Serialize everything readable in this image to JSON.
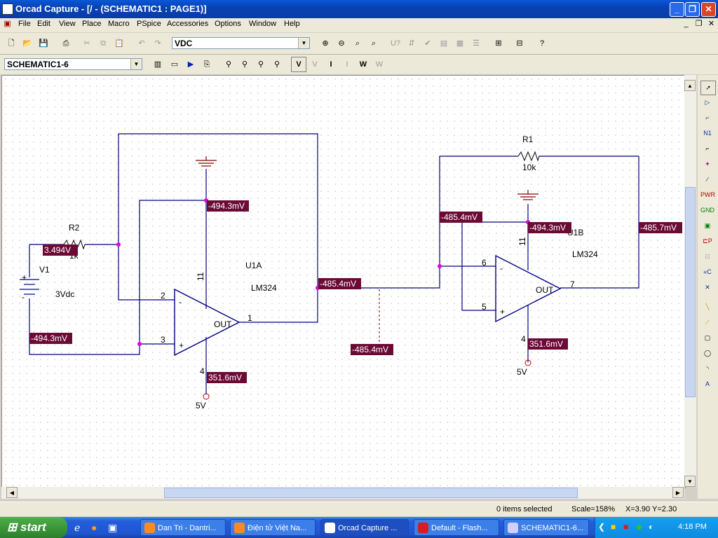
{
  "window": {
    "title": "Orcad Capture - [/ - (SCHEMATIC1 : PAGE1)]"
  },
  "menu": [
    "File",
    "Edit",
    "View",
    "Place",
    "Macro",
    "PSpice",
    "Accessories",
    "Options",
    "Window",
    "Help"
  ],
  "toolbar": {
    "profile_combo": "VDC",
    "page_combo": "SCHEMATIC1-6"
  },
  "schematic": {
    "parts": {
      "r2_ref": "R2",
      "r2_val": "1k",
      "v1_ref": "V1",
      "v1_val": "3Vdc",
      "u1a_ref": "U1A",
      "u1a_val": "LM324",
      "r1_ref": "R1",
      "r1_val": "10k",
      "u1b_ref": "U1B",
      "u1b_val": "LM324",
      "supply_u1a": "5V",
      "supply_u1b": "5V"
    },
    "pins": {
      "u1a_pin2": "2",
      "u1a_pin3": "3",
      "u1a_pin1": "1",
      "u1a_pin11": "11",
      "u1a_pin4": "4",
      "u1a_minus": "-",
      "u1a_plus": "+",
      "u1a_out": "OUT",
      "u1b_pin6": "6",
      "u1b_pin5": "5",
      "u1b_pin7": "7",
      "u1b_pin11": "11",
      "u1b_pin4": "4",
      "u1b_minus": "-",
      "u1b_plus": "+",
      "u1b_out": "OUT",
      "v1_plus": "+",
      "v1_minus": "-"
    },
    "voltages": {
      "v_top_u1a": "-494.3mV",
      "v_r2": "3.494V",
      "v_v1_neg": "-494.3mV",
      "v_u1a_out": "-485.4mV",
      "v_probe": "-485.4mV",
      "v_u1a_pin4": "351.6mV",
      "v_u1b_inv": "-485.4mV",
      "v_u1b_pin11": "-494.3mV",
      "v_u1b_out": "-485.7mV",
      "v_u1b_pin4": "351.6mV"
    }
  },
  "status": {
    "selection": "0 items selected",
    "scale": "Scale=158%",
    "coords": "X=3.90  Y=2.30"
  },
  "taskbar": {
    "start": "start",
    "tasks": [
      "Dan Tri - Dantri...",
      "Điện tử Việt Na...",
      "Orcad Capture ...",
      "Default - Flash...",
      "SCHEMATIC1-6..."
    ],
    "clock": "4:18 PM"
  },
  "colors": {
    "wire": "#000080",
    "voltage_bg": "#6b0a35",
    "junction": "#e000e0",
    "titlebar": "#0a58d8"
  }
}
